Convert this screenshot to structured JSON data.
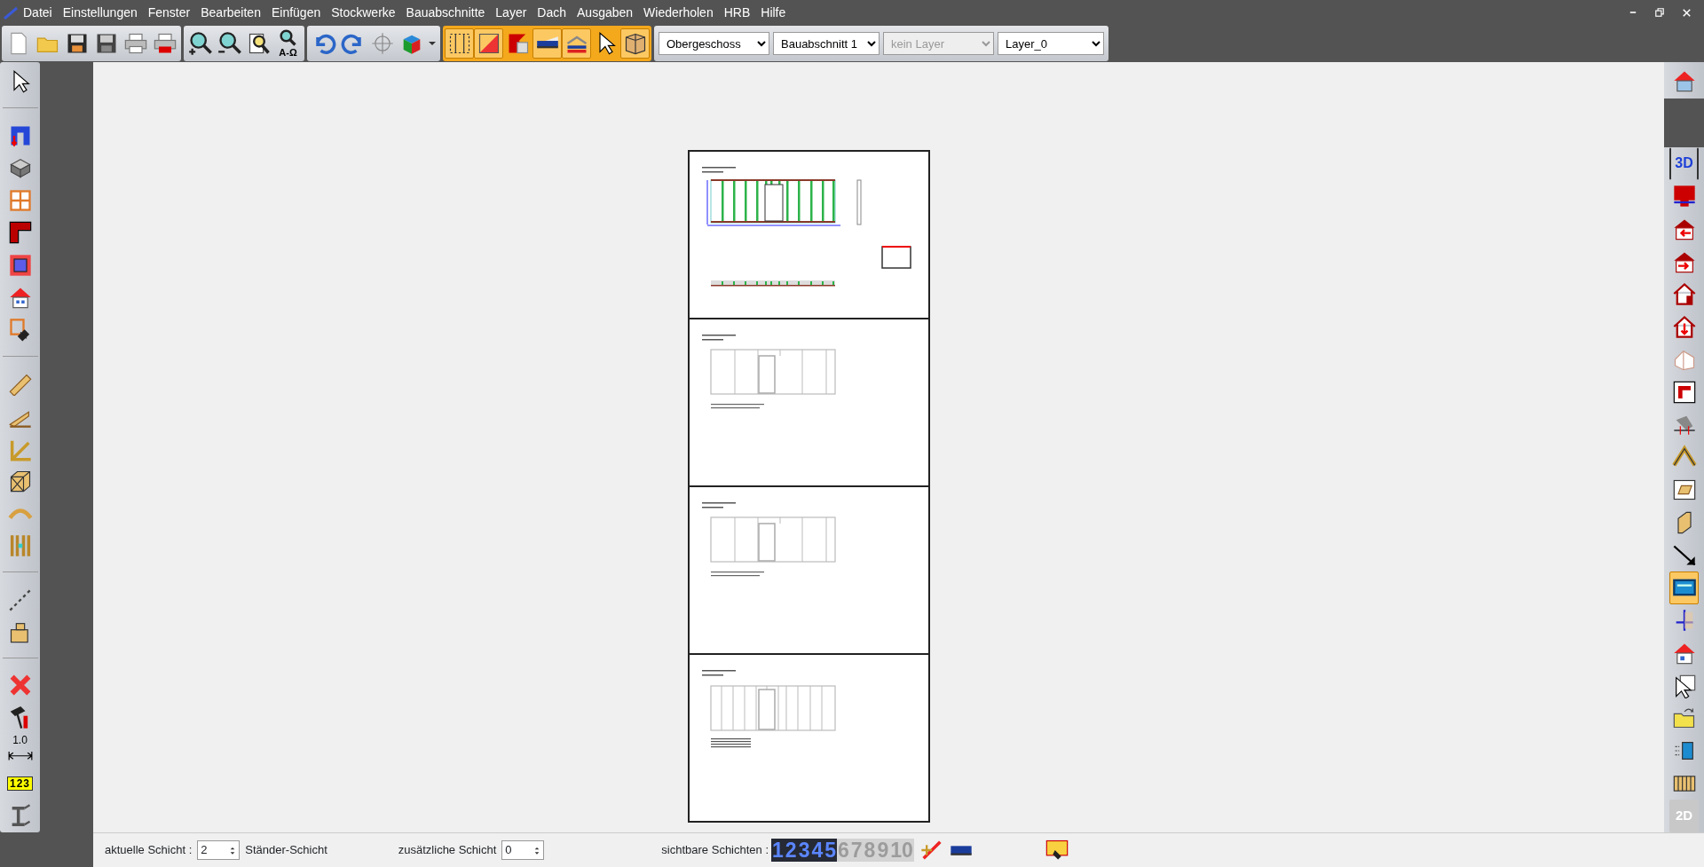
{
  "menu": [
    {
      "label": "Datei"
    },
    {
      "label": "Einstellungen"
    },
    {
      "label": "Fenster"
    },
    {
      "label": "Bearbeiten"
    },
    {
      "label": "Einfügen"
    },
    {
      "label": "Stockwerke"
    },
    {
      "label": "Bauabschnitte"
    },
    {
      "label": "Layer"
    },
    {
      "label": "Dach"
    },
    {
      "label": "Ausgaben"
    },
    {
      "label": "Wiederholen"
    },
    {
      "label": "HRB"
    },
    {
      "label": "Hilfe"
    }
  ],
  "toolbar": {
    "text_zoom_label": "A-Ω",
    "mode_buttons": [
      {
        "on": true
      },
      {
        "on": true
      },
      {
        "on": false
      },
      {
        "on": true
      },
      {
        "on": true
      },
      {
        "on": false
      },
      {
        "on": true
      }
    ]
  },
  "selectors": [
    {
      "value": "Obergeschoss",
      "disabled": false
    },
    {
      "value": "Bauabschnitt 1",
      "disabled": false
    },
    {
      "value": "kein Layer",
      "disabled": true
    },
    {
      "value": "Layer_0",
      "disabled": false
    }
  ],
  "left_toolbar": {
    "dimension_label": "1.0",
    "ruler_label": "123"
  },
  "right_toolbar": {
    "buttons": [
      {
        "kind": "text",
        "label": "3D",
        "disabled": false
      },
      {
        "kind": "icon",
        "on": false
      },
      {
        "kind": "icon",
        "on": false
      },
      {
        "kind": "icon",
        "on": false
      },
      {
        "kind": "icon",
        "on": false
      },
      {
        "kind": "icon",
        "on": false
      },
      {
        "kind": "icon",
        "on": false
      },
      {
        "kind": "icon",
        "on": false
      },
      {
        "kind": "icon",
        "on": false
      },
      {
        "kind": "icon",
        "on": false
      },
      {
        "kind": "icon",
        "on": false
      },
      {
        "kind": "icon",
        "on": false
      },
      {
        "kind": "icon",
        "on": false
      },
      {
        "kind": "icon",
        "on": true
      },
      {
        "kind": "icon",
        "on": false
      },
      {
        "kind": "icon",
        "on": false
      },
      {
        "kind": "icon",
        "on": false
      },
      {
        "kind": "icon",
        "on": false
      },
      {
        "kind": "icon",
        "on": false
      },
      {
        "kind": "icon",
        "on": false
      },
      {
        "kind": "text",
        "label": "2D",
        "disabled": true
      }
    ]
  },
  "sheets": [
    {
      "kind": "framing"
    },
    {
      "kind": "panels"
    },
    {
      "kind": "panels"
    },
    {
      "kind": "battens"
    }
  ],
  "status_bar": {
    "current_layer_label": "aktuelle Schicht :",
    "current_layer": "2",
    "current_layer_name": "Ständer-Schicht",
    "extra_layer_label": "zusätzliche Schicht",
    "extra_layer": "0",
    "visible_label": "sichtbare Schichten :",
    "layers": [
      {
        "label": "1",
        "visible": true
      },
      {
        "label": "2",
        "visible": true
      },
      {
        "label": "3",
        "visible": true
      },
      {
        "label": "4",
        "visible": true
      },
      {
        "label": "5",
        "visible": true
      },
      {
        "label": "6",
        "visible": false
      },
      {
        "label": "7",
        "visible": false
      },
      {
        "label": "8",
        "visible": false
      },
      {
        "label": "9",
        "visible": false
      },
      {
        "label": "10",
        "visible": false
      }
    ]
  }
}
